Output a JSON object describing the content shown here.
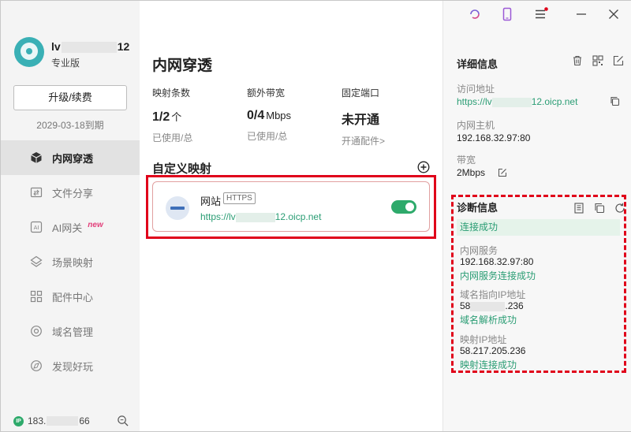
{
  "sidebar": {
    "username_start": "lv",
    "username_end": "12",
    "edition": "专业版",
    "upgrade_label": "升级/续费",
    "expire": "2029-03-18到期",
    "items": [
      {
        "label": "内网穿透",
        "icon": "cube-icon",
        "active": true
      },
      {
        "label": "文件分享",
        "icon": "folder-share-icon",
        "active": false
      },
      {
        "label": "AI网关",
        "icon": "ai-icon",
        "active": false,
        "badge": "new"
      },
      {
        "label": "场景映射",
        "icon": "scene-icon",
        "active": false
      },
      {
        "label": "配件中心",
        "icon": "grid-icon",
        "active": false
      },
      {
        "label": "域名管理",
        "icon": "domain-icon",
        "active": false
      },
      {
        "label": "发现好玩",
        "icon": "discover-icon",
        "active": false
      }
    ],
    "ip_start": "183.",
    "ip_end": "66"
  },
  "main": {
    "title": "内网穿透",
    "stats": [
      {
        "label": "映射条数",
        "value": "1/2",
        "unit": "个",
        "sub": "已使用/总"
      },
      {
        "label": "额外带宽",
        "value": "0/4",
        "unit": "Mbps",
        "sub": "已使用/总"
      },
      {
        "label": "固定端口",
        "value": "未开通",
        "unit": "",
        "sub": "开通配件>"
      }
    ],
    "section_title": "自定义映射",
    "mapping": {
      "name": "网站",
      "protocol": "HTTPS",
      "url_start": "https://lv",
      "url_end": "12.oicp.net",
      "enabled": true
    }
  },
  "detail": {
    "title": "详细信息",
    "access_label": "访问地址",
    "access_url_start": "https://lv",
    "access_url_end": "12.oicp.net",
    "host_label": "内网主机",
    "host_value": "192.168.32.97:80",
    "bandwidth_label": "带宽",
    "bandwidth_value": "2Mbps",
    "diag": {
      "title": "诊断信息",
      "status": "连接成功",
      "service_label": "内网服务",
      "service_value": "192.168.32.97:80",
      "service_ok": "内网服务连接成功",
      "dns_label": "域名指向IP地址",
      "dns_value_start": "58",
      "dns_value_end": ".236",
      "dns_ok": "域名解析成功",
      "map_label": "映射IP地址",
      "map_value": "58.217.205.236",
      "map_ok": "映射连接成功"
    }
  },
  "colors": {
    "accent": "#2eaa6b",
    "highlight": "#e0001a",
    "badge": "#e23f7a"
  }
}
